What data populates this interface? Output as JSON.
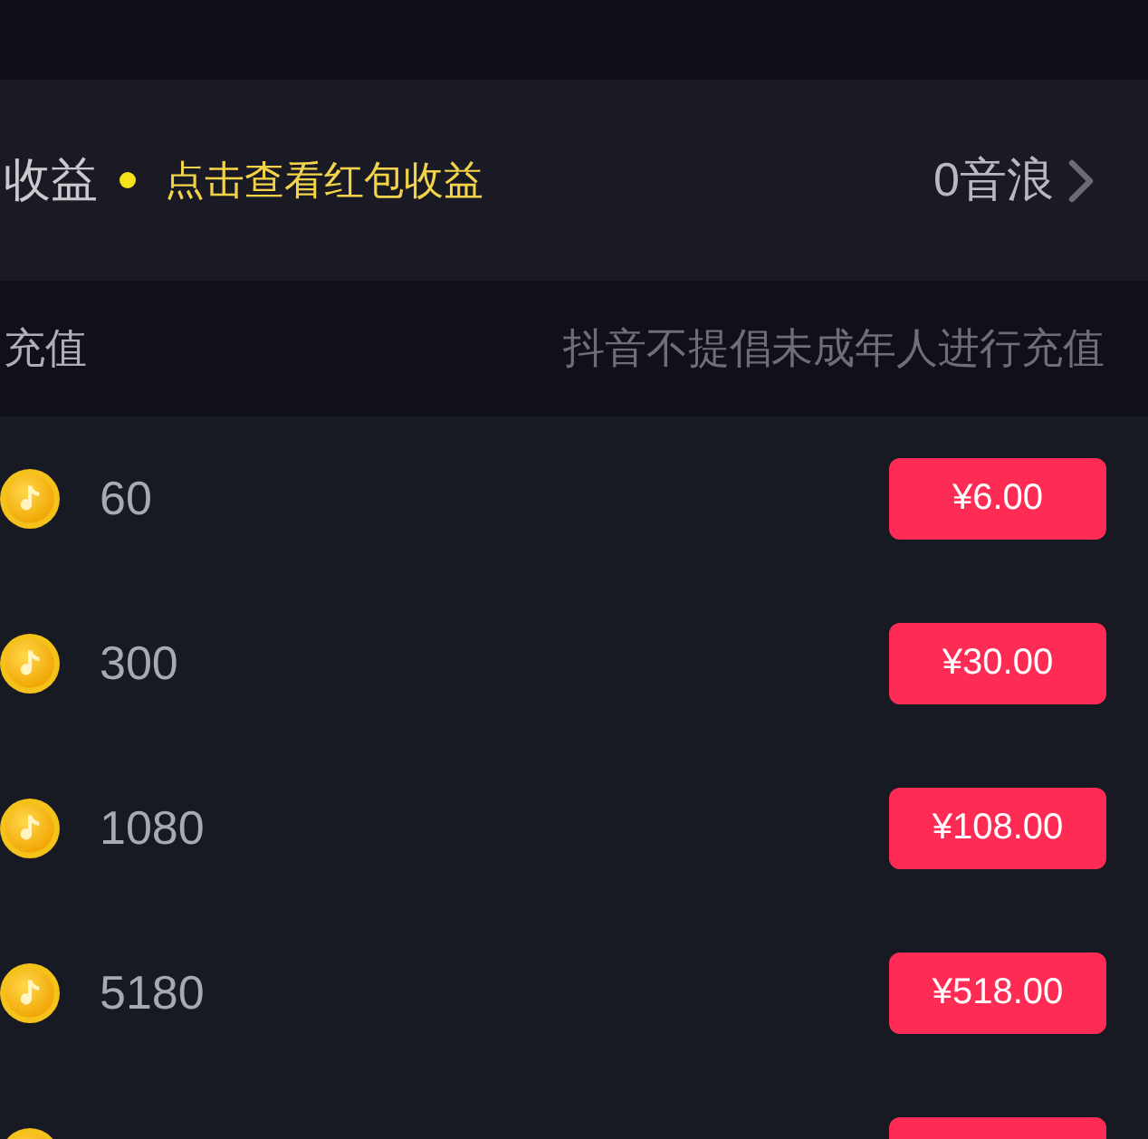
{
  "income": {
    "label": "收益",
    "unread": true,
    "hint": "点击查看红包收益",
    "value": "0音浪"
  },
  "recharge": {
    "label": "充值",
    "notice": "抖音不提倡未成年人进行充值",
    "packages": [
      {
        "kind": "full",
        "amount": "60",
        "price": "¥6.00"
      },
      {
        "kind": "full",
        "amount": "300",
        "price": "¥30.00"
      },
      {
        "kind": "full",
        "amount": "1080",
        "price": "¥108.00"
      },
      {
        "kind": "full",
        "amount": "5180",
        "price": "¥518.00"
      },
      {
        "kind": "cut"
      }
    ]
  }
}
